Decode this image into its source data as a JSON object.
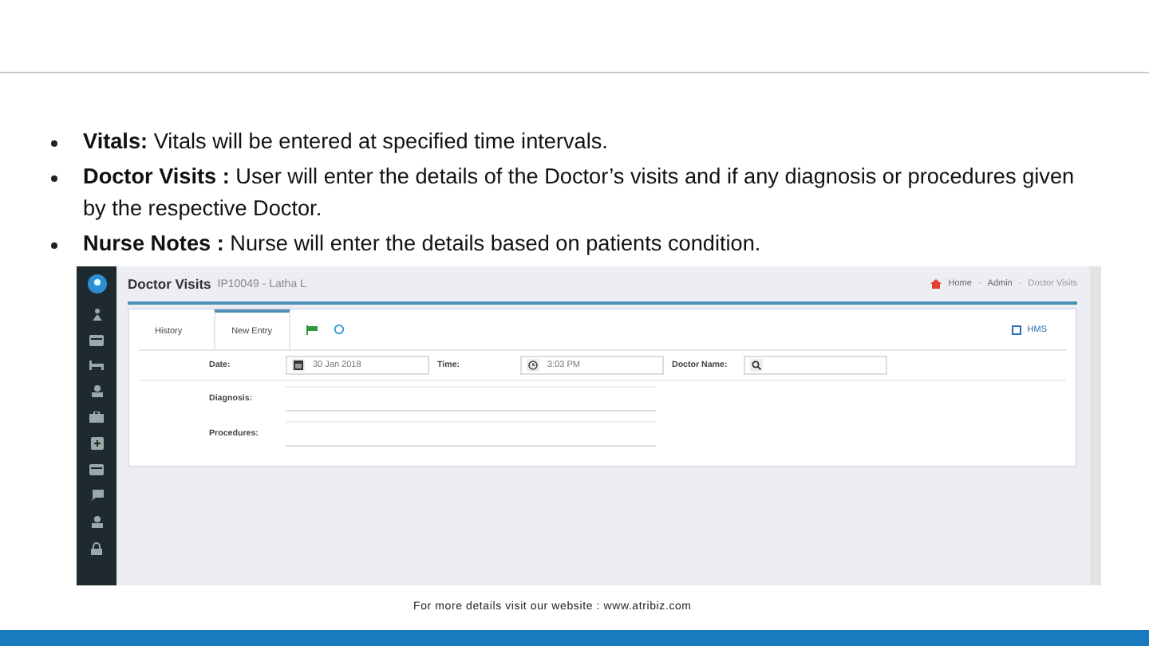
{
  "bullets": [
    {
      "text": "**Vitals:** Vitals will be entered at specified time intervals."
    },
    {
      "text": "**Doctor Visits :** User will enter the details of the Doctor’s visits and if any diagnosis or procedures given by the respective Doctor."
    },
    {
      "text": "**Nurse Notes :** Nurse will enter the details based on patients condition."
    }
  ],
  "app": {
    "title": "Doctor Visits",
    "patient": "IP10049 - Latha L",
    "breadcrumb": {
      "items": [
        "Home",
        "Admin",
        "Doctor Visits"
      ],
      "separator": "-"
    },
    "tabs": [
      {
        "label": "History",
        "selected": false
      },
      {
        "label": "New Entry",
        "selected": true
      }
    ],
    "hms_link": "HMS",
    "fields": [
      {
        "kind": "date",
        "label": "Date:",
        "value": "30 Jan 2018"
      },
      {
        "kind": "time",
        "label": "Time:",
        "value": "3:03 PM"
      },
      {
        "kind": "search",
        "label": "Doctor Name:"
      }
    ],
    "textareas": [
      {
        "label": "Diagnosis:"
      },
      {
        "label": "Procedures:"
      }
    ]
  },
  "footer": "For more details visit our website : www.atribiz.com"
}
